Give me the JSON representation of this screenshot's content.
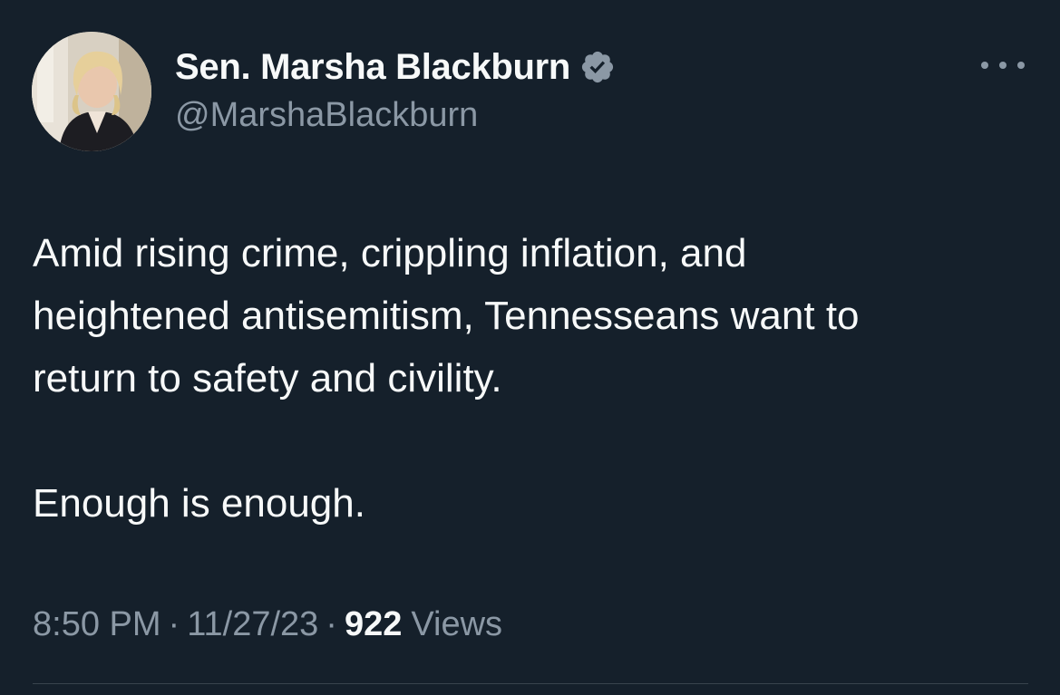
{
  "author": {
    "display_name": "Sen. Marsha Blackburn",
    "handle": "@MarshaBlackburn",
    "verified_icon": "verified-badge-icon",
    "verified_color": "#8b98a5"
  },
  "tweet": {
    "lines": [
      "Amid rising crime, crippling inflation, and",
      "heightened antisemitism, Tennesseans want to",
      "return to safety and civility.",
      "Enough is enough."
    ]
  },
  "meta": {
    "time": "8:50 PM",
    "separator": "·",
    "date": "11/27/23",
    "views_count": "922",
    "views_label": "Views"
  },
  "colors": {
    "background": "#15202b",
    "primary_text": "#f7f9f9",
    "secondary_text": "#8b98a5",
    "divider": "#38444d"
  }
}
